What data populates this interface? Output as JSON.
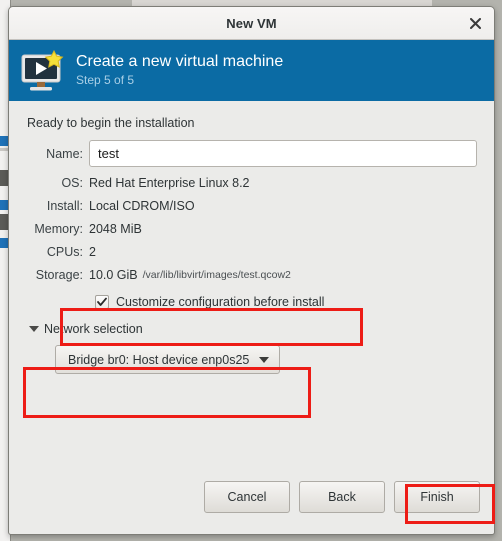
{
  "window": {
    "title": "New VM",
    "close_icon": "close-icon"
  },
  "banner": {
    "title": "Create a new virtual machine",
    "step": "Step 5 of 5",
    "icon": "virtual-machine-new-icon"
  },
  "content": {
    "ready_text": "Ready to begin the installation",
    "fields": [
      {
        "label": "Name:",
        "value": "test",
        "type": "input"
      },
      {
        "label": "OS:",
        "value": "Red Hat Enterprise Linux 8.2",
        "type": "text"
      },
      {
        "label": "Install:",
        "value": "Local CDROM/ISO",
        "type": "text"
      },
      {
        "label": "Memory:",
        "value": "2048 MiB",
        "type": "text"
      },
      {
        "label": "CPUs:",
        "value": "2",
        "type": "text"
      },
      {
        "label": "Storage:",
        "value": "10.0 GiB",
        "extra": "/var/lib/libvirt/images/test.qcow2",
        "type": "text"
      }
    ],
    "customize_checkbox": {
      "label": "Customize configuration before install",
      "checked": true
    },
    "expander": {
      "label": "Network selection",
      "expanded": true
    },
    "network_combo": {
      "value": "Bridge br0: Host device enp0s25"
    }
  },
  "footer": {
    "cancel_label": "Cancel",
    "back_label": "Back",
    "finish_label": "Finish"
  },
  "annotations": {
    "highlight_color": "#ed1c16",
    "boxes": [
      "customize-checkbox",
      "network-selection-combo",
      "finish-button"
    ]
  }
}
